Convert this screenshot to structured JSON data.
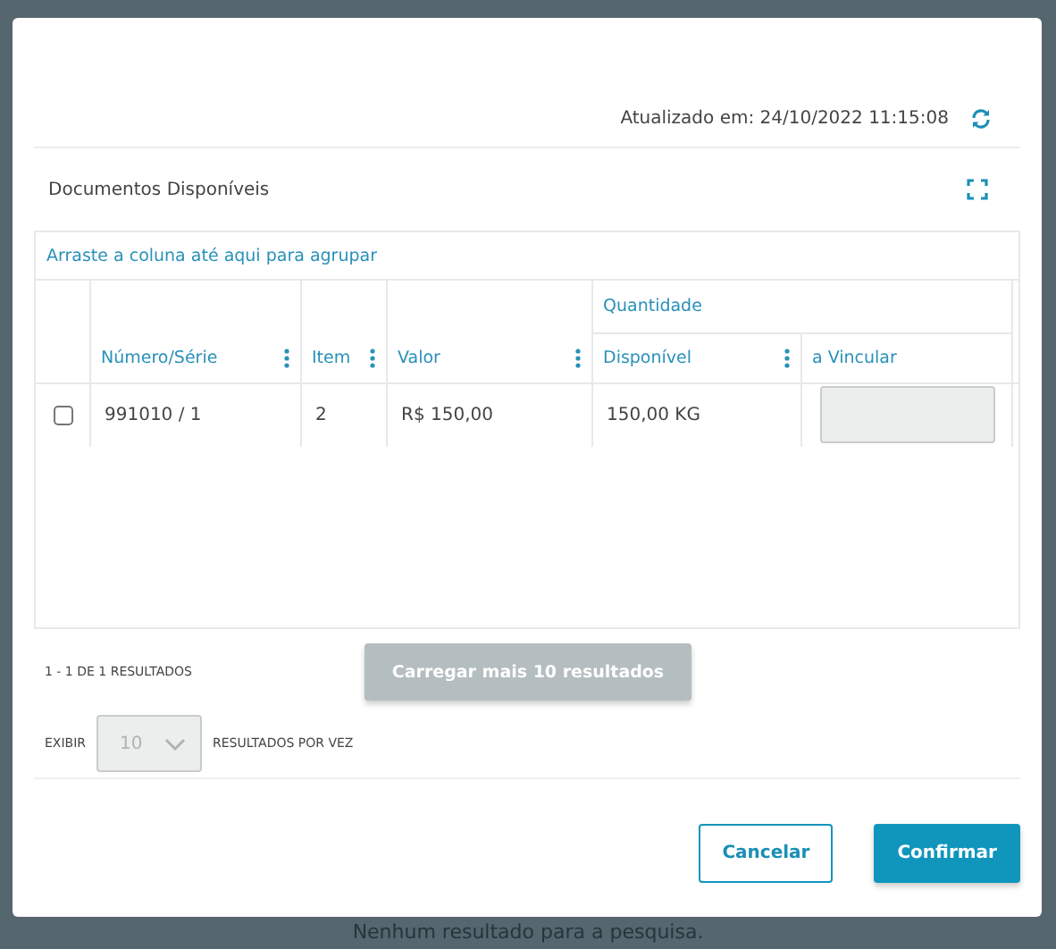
{
  "background": {
    "empty_message": "Nenhum resultado para a pesquisa."
  },
  "modal": {
    "updated_at": "Atualizado em: 24/10/2022 11:15:08",
    "panel_title": "Documentos Disponíveis",
    "group_hint": "Arraste a coluna até aqui para agrupar",
    "columns": [
      {
        "label": "Número/Série",
        "menu": true
      },
      {
        "label": "Item",
        "menu": true
      },
      {
        "label": "Valor",
        "menu": true
      }
    ],
    "column_group": {
      "label": "Quantidade",
      "columns": [
        {
          "label": "Disponível",
          "menu": true
        },
        {
          "label": "a Vincular",
          "menu": false
        }
      ]
    },
    "rows": [
      {
        "checked": false,
        "cells": [
          "991010 / 1",
          "2",
          "R$ 150,00",
          "150,00 KG"
        ],
        "link_field": {
          "disabled": true
        }
      }
    ],
    "result_count": "1 - 1 DE 1 RESULTADOS",
    "load_more": {
      "label": "Carregar mais 10 resultados",
      "disabled": true
    },
    "page_size": {
      "label_before": "EXIBIR",
      "value": "10",
      "disabled": true,
      "label_after": "RESULTADOS POR VEZ"
    },
    "buttons": [
      {
        "label": "Cancelar",
        "kind": "secondary"
      },
      {
        "label": "Confirmar",
        "kind": "primary"
      }
    ]
  }
}
